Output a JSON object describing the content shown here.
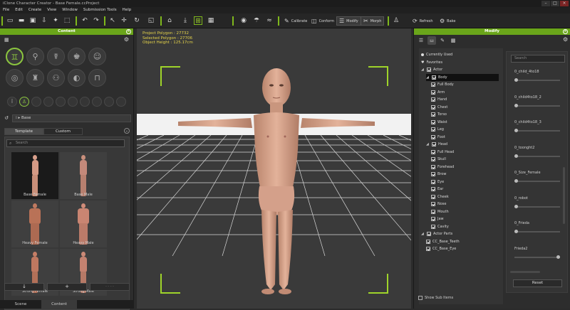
{
  "window": {
    "title": "iClone Character Creator - Base Female.ccProject"
  },
  "menu": [
    "File",
    "Edit",
    "Create",
    "View",
    "Window",
    "Submission Tools",
    "Help"
  ],
  "toolbar": {
    "calibrate_label": "Calibrate",
    "conform_label": "Conform",
    "modify_label": "Modify",
    "morph_label": "Morph",
    "refresh_label": "Refresh",
    "bake_label": "Bake"
  },
  "content_panel": {
    "title": "Content",
    "breadcrumb": "Base",
    "tabs": [
      "Template",
      "Custom"
    ],
    "search_placeholder": "Search",
    "items": [
      {
        "label": "Base Female",
        "selected": true
      },
      {
        "label": "Base Male",
        "selected": false
      },
      {
        "label": "Heavy Female",
        "selected": false
      },
      {
        "label": "Heavy Male",
        "selected": false
      },
      {
        "label": "Strong Female",
        "selected": false
      },
      {
        "label": "Strong Male",
        "selected": false
      }
    ],
    "bottom_tabs": [
      "Scene",
      "Content"
    ]
  },
  "viewport": {
    "project_polygon": "Project Polygon : 27732",
    "selected_polygon": "Selected Polygon : 27706",
    "object_height": "Object Height : 125.17cm",
    "accent_color": "#9fd42a"
  },
  "modify_panel": {
    "title": "Modify",
    "tree": [
      {
        "label": "Currently Used",
        "level": 0,
        "kind": "dot"
      },
      {
        "label": "Favorites",
        "level": 0,
        "kind": "heart"
      },
      {
        "label": "Actor",
        "level": 0,
        "kind": "group"
      },
      {
        "label": "Body",
        "level": 1,
        "kind": "group",
        "highlight": true
      },
      {
        "label": "Full Body",
        "level": 2,
        "kind": "check"
      },
      {
        "label": "Arm",
        "level": 2,
        "kind": "check"
      },
      {
        "label": "Hand",
        "level": 2,
        "kind": "check"
      },
      {
        "label": "Chest",
        "level": 2,
        "kind": "check"
      },
      {
        "label": "Torso",
        "level": 2,
        "kind": "check"
      },
      {
        "label": "Waist",
        "level": 2,
        "kind": "check"
      },
      {
        "label": "Leg",
        "level": 2,
        "kind": "check"
      },
      {
        "label": "Foot",
        "level": 2,
        "kind": "check"
      },
      {
        "label": "Head",
        "level": 1,
        "kind": "group"
      },
      {
        "label": "Full Head",
        "level": 2,
        "kind": "check"
      },
      {
        "label": "Skull",
        "level": 2,
        "kind": "check"
      },
      {
        "label": "Forehead",
        "level": 2,
        "kind": "check"
      },
      {
        "label": "Brow",
        "level": 2,
        "kind": "check"
      },
      {
        "label": "Eye",
        "level": 2,
        "kind": "check"
      },
      {
        "label": "Ear",
        "level": 2,
        "kind": "check"
      },
      {
        "label": "Cheek",
        "level": 2,
        "kind": "check"
      },
      {
        "label": "Nose",
        "level": 2,
        "kind": "check"
      },
      {
        "label": "Mouth",
        "level": 2,
        "kind": "check"
      },
      {
        "label": "Jaw",
        "level": 2,
        "kind": "check"
      },
      {
        "label": "Cavity",
        "level": 2,
        "kind": "check"
      },
      {
        "label": "Actor Parts",
        "level": 0,
        "kind": "group"
      },
      {
        "label": "CC_Base_Teeth",
        "level": 1,
        "kind": "check"
      },
      {
        "label": "CC_Base_Eye",
        "level": 1,
        "kind": "check"
      }
    ],
    "show_sub_items": "Show Sub Items",
    "search_placeholder": "Search",
    "morphs": [
      {
        "label": "0_child_4to18",
        "value": 0.0
      },
      {
        "label": "0_child4to18_2",
        "value": 0.0
      },
      {
        "label": "0_child4to18_3",
        "value": 0.0
      },
      {
        "label": "0_toonght2",
        "value": 0.0
      },
      {
        "label": "0_Size_Female",
        "value": 0.0
      },
      {
        "label": "0_robot",
        "value": 0.0
      },
      {
        "label": "0_Frieda",
        "value": 0.0
      },
      {
        "label": "Frieda2",
        "value": 1.0
      }
    ],
    "reset_label": "Reset"
  }
}
